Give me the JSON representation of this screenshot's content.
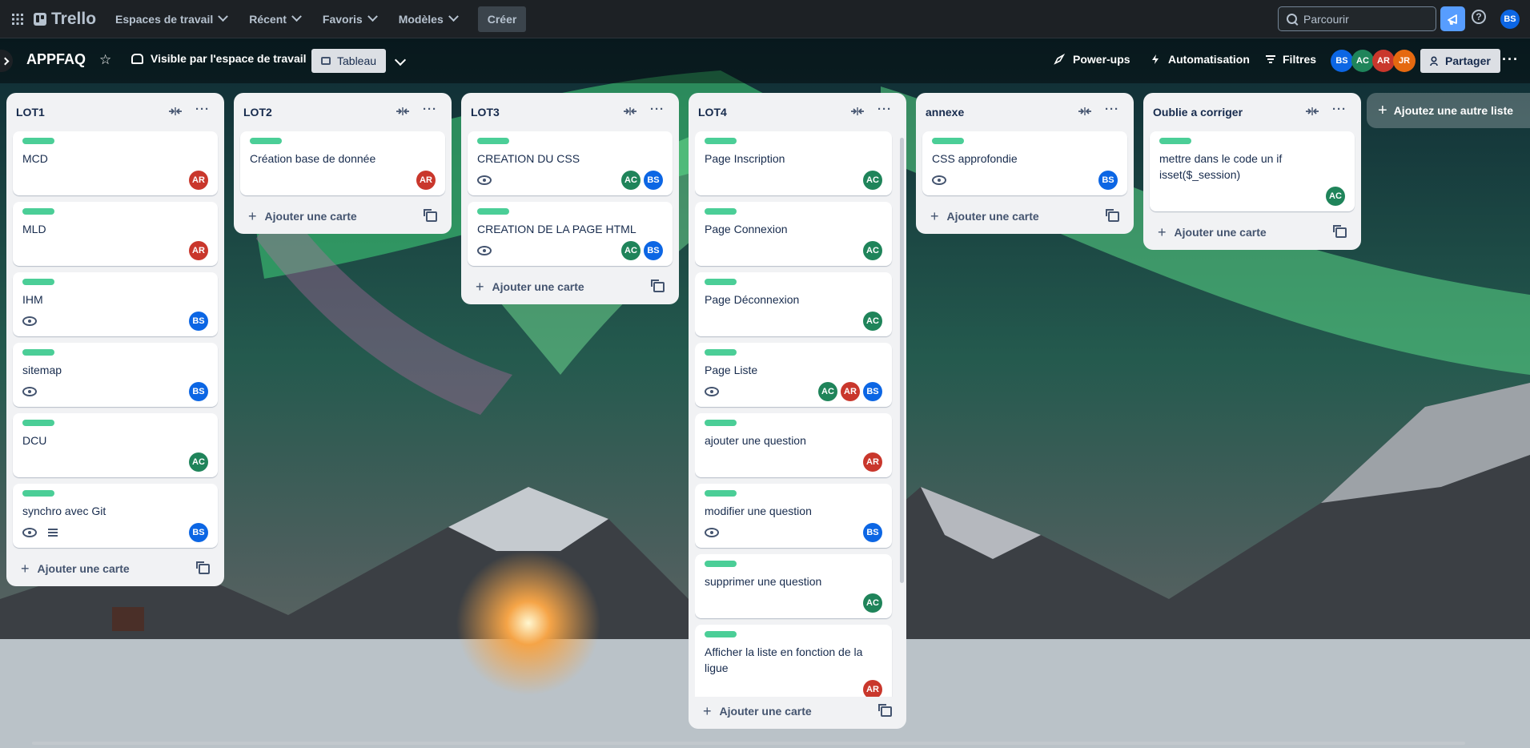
{
  "nav": {
    "brand": "Trello",
    "items": [
      {
        "label": "Espaces de travail"
      },
      {
        "label": "Récent"
      },
      {
        "label": "Favoris"
      },
      {
        "label": "Modèles"
      }
    ],
    "create_label": "Créer",
    "search_placeholder": "Parcourir",
    "user_initials": "BS"
  },
  "board": {
    "title": "APPFAQ",
    "visibility": "Visible par l'espace de travail",
    "view_label": "Tableau",
    "powerups_label": "Power-ups",
    "automation_label": "Automatisation",
    "filters_label": "Filtres",
    "share_label": "Partager",
    "members": [
      {
        "initials": "BS",
        "color": "#0c66e4"
      },
      {
        "initials": "AC",
        "color": "#1f845a"
      },
      {
        "initials": "AR",
        "color": "#c9372c"
      },
      {
        "initials": "JR",
        "color": "#e56910"
      }
    ]
  },
  "colors": {
    "label_green": "#4bce97",
    "AR": "#c9372c",
    "AC": "#1f845a",
    "BS": "#0c66e4"
  },
  "add_card_label": "Ajouter une carte",
  "add_list_label": "Ajoutez une autre liste",
  "lists": [
    {
      "title": "LOT1",
      "cards": [
        {
          "title": "MCD",
          "watch": false,
          "desc": false,
          "members": [
            "AR"
          ]
        },
        {
          "title": "MLD",
          "watch": false,
          "desc": false,
          "members": [
            "AR"
          ]
        },
        {
          "title": "IHM",
          "watch": true,
          "desc": false,
          "members": [
            "BS"
          ]
        },
        {
          "title": "sitemap",
          "watch": true,
          "desc": false,
          "members": [
            "BS"
          ]
        },
        {
          "title": "DCU",
          "watch": false,
          "desc": false,
          "members": [
            "AC"
          ]
        },
        {
          "title": "synchro avec Git",
          "watch": true,
          "desc": true,
          "members": [
            "BS"
          ]
        }
      ]
    },
    {
      "title": "LOT2",
      "cards": [
        {
          "title": "Création base de donnée",
          "watch": false,
          "desc": false,
          "members": [
            "AR"
          ]
        }
      ]
    },
    {
      "title": "LOT3",
      "cards": [
        {
          "title": "CREATION DU CSS",
          "watch": true,
          "desc": false,
          "members": [
            "AC",
            "BS"
          ]
        },
        {
          "title": "CREATION DE LA PAGE HTML",
          "watch": true,
          "desc": false,
          "members": [
            "AC",
            "BS"
          ]
        }
      ]
    },
    {
      "title": "LOT4",
      "cards": [
        {
          "title": "Page Inscription",
          "watch": false,
          "desc": false,
          "members": [
            "AC"
          ]
        },
        {
          "title": "Page Connexion",
          "watch": false,
          "desc": false,
          "members": [
            "AC"
          ]
        },
        {
          "title": "Page Déconnexion",
          "watch": false,
          "desc": false,
          "members": [
            "AC"
          ]
        },
        {
          "title": "Page Liste",
          "watch": true,
          "desc": false,
          "members": [
            "AC",
            "AR",
            "BS"
          ]
        },
        {
          "title": "ajouter une question",
          "watch": false,
          "desc": false,
          "members": [
            "AR"
          ]
        },
        {
          "title": "modifier une question",
          "watch": true,
          "desc": false,
          "members": [
            "BS"
          ]
        },
        {
          "title": "supprimer une question",
          "watch": false,
          "desc": false,
          "members": [
            "AC"
          ]
        },
        {
          "title": "Afficher la liste en fonction de la ligue",
          "watch": false,
          "desc": false,
          "members": [
            "AR"
          ]
        },
        {
          "title": "",
          "watch": false,
          "desc": false,
          "members": []
        }
      ]
    },
    {
      "title": "annexe",
      "cards": [
        {
          "title": "CSS approfondie",
          "watch": true,
          "desc": false,
          "members": [
            "BS"
          ]
        }
      ]
    },
    {
      "title": "Oublie a corriger",
      "cards": [
        {
          "title": "mettre dans le code un if isset($_session)",
          "watch": false,
          "desc": false,
          "members": [
            "AC"
          ]
        }
      ]
    }
  ]
}
